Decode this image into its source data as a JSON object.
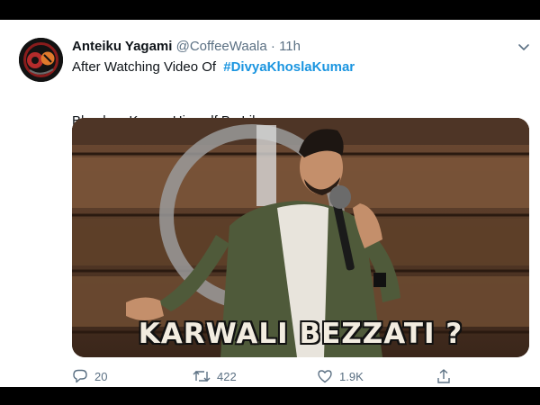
{
  "tweet": {
    "author_name": "Anteiku Yagami",
    "handle": "@CoffeeWaala",
    "separator": "·",
    "time": "11h",
    "text_line1": "After Watching Video Of",
    "hashtag": "#DivyaKhoslaKumar",
    "text_line2": "Bhushan Kumar Himself Be Like:",
    "media_caption": "KARWALI BEZZATI ?"
  },
  "actions": {
    "reply_count": "20",
    "retweet_count": "422",
    "like_count": "1.9K"
  },
  "icons": {
    "more": "chevron-down-icon",
    "reply": "reply-icon",
    "retweet": "retweet-icon",
    "like": "heart-icon",
    "share": "share-icon"
  },
  "colors": {
    "hashtag": "#1b95e0",
    "secondary_text": "#5b7083",
    "frame": "#000000"
  }
}
